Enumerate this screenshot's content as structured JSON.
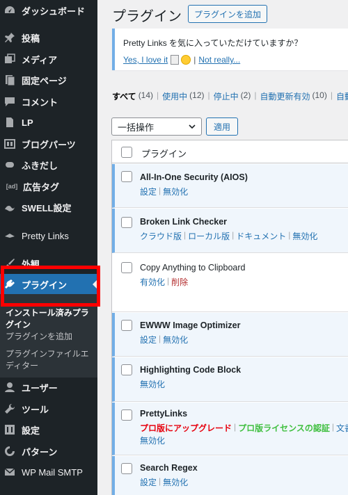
{
  "sidebar": {
    "items": [
      {
        "label": "ダッシュボード",
        "icon": "dashboard-icon"
      },
      {
        "label": "投稿",
        "icon": "pin-icon"
      },
      {
        "label": "メディア",
        "icon": "media-icon"
      },
      {
        "label": "固定ページ",
        "icon": "page-icon"
      },
      {
        "label": "コメント",
        "icon": "comment-icon"
      },
      {
        "label": "LP",
        "icon": "document-icon"
      },
      {
        "label": "ブログパーツ",
        "icon": "layout-icon"
      },
      {
        "label": "ふきだし",
        "icon": "speech-icon"
      },
      {
        "label": "広告タグ",
        "icon": "ad-icon",
        "glyph": "[ad]"
      },
      {
        "label": "SWELL設定",
        "icon": "swell-icon"
      },
      {
        "label": "Pretty Links",
        "icon": "pretty-links-icon"
      },
      {
        "label": "外観",
        "icon": "brush-icon"
      },
      {
        "label": "プラグイン",
        "icon": "plugin-icon"
      },
      {
        "label": "ユーザー",
        "icon": "user-icon"
      },
      {
        "label": "ツール",
        "icon": "wrench-icon"
      },
      {
        "label": "設定",
        "icon": "settings-icon"
      },
      {
        "label": "パターン",
        "icon": "pattern-icon"
      },
      {
        "label": "WP Mail SMTP",
        "icon": "mail-icon"
      }
    ],
    "submenu": [
      "インストール済みプラグイン",
      "プラグインを追加",
      "プラグインファイルエディター"
    ]
  },
  "header": {
    "title": "プラグイン",
    "add_button": "プラグインを追加"
  },
  "notice": {
    "text": "Pretty Links を気に入っていただけていますか？",
    "yes": "Yes, I love it",
    "no": "Not really..."
  },
  "filters": [
    {
      "label": "すべて",
      "count": "(14)"
    },
    {
      "label": "使用中",
      "count": "(12)"
    },
    {
      "label": "停止中",
      "count": "(2)"
    },
    {
      "label": "自動更新有効",
      "count": "(10)"
    },
    {
      "label": "自動更",
      "count": ""
    }
  ],
  "bulk": {
    "selected": "一括操作",
    "apply": "適用"
  },
  "table": {
    "column": "プラグイン",
    "plugins": [
      {
        "name": "All-In-One Security (AIOS)",
        "actions": [
          "設定",
          "無効化"
        ]
      },
      {
        "name": "Broken Link Checker",
        "actions": [
          "クラウド版",
          "ローカル版",
          "ドキュメント",
          "無効化"
        ]
      },
      {
        "name": "Copy Anything to Clipboard",
        "actions": [
          "有効化",
          "削除"
        ]
      },
      {
        "name": "EWWW Image Optimizer",
        "actions": [
          "設定",
          "無効化"
        ]
      },
      {
        "name": "Highlighting Code Block",
        "actions": [
          "無効化"
        ]
      },
      {
        "name": "PrettyLinks",
        "actions": [
          "プロ版にアップグレード",
          "プロ版ライセンスの認証",
          "文書"
        ],
        "actions2": [
          "無効化"
        ]
      },
      {
        "name": "Search Regex",
        "actions": [
          "設定",
          "無効化"
        ]
      }
    ]
  },
  "colors": {
    "sidebar_bg": "#1d2327",
    "accent": "#2271b1",
    "highlight_box": "#ff0000"
  }
}
